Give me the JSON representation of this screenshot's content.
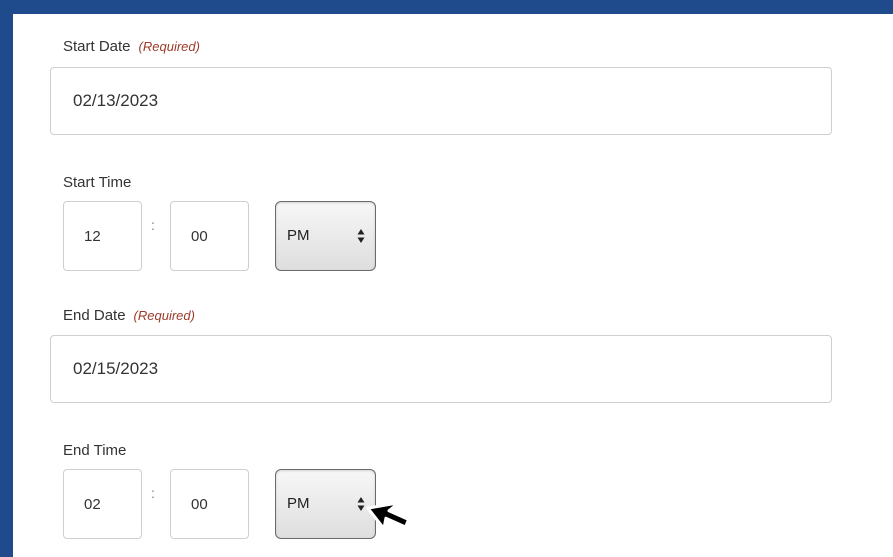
{
  "start_date": {
    "label": "Start Date",
    "required": "(Required)",
    "value": "02/13/2023"
  },
  "start_time": {
    "label": "Start Time",
    "hour": "12",
    "separator": ":",
    "minute": "00",
    "period": "PM"
  },
  "end_date": {
    "label": "End Date",
    "required": "(Required)",
    "value": "02/15/2023"
  },
  "end_time": {
    "label": "End Time",
    "hour": "02",
    "separator": ":",
    "minute": "00",
    "period": "PM"
  },
  "icons": {
    "select_arrows": "up-down-arrows-icon",
    "cursor": "mouse-pointer-icon"
  }
}
